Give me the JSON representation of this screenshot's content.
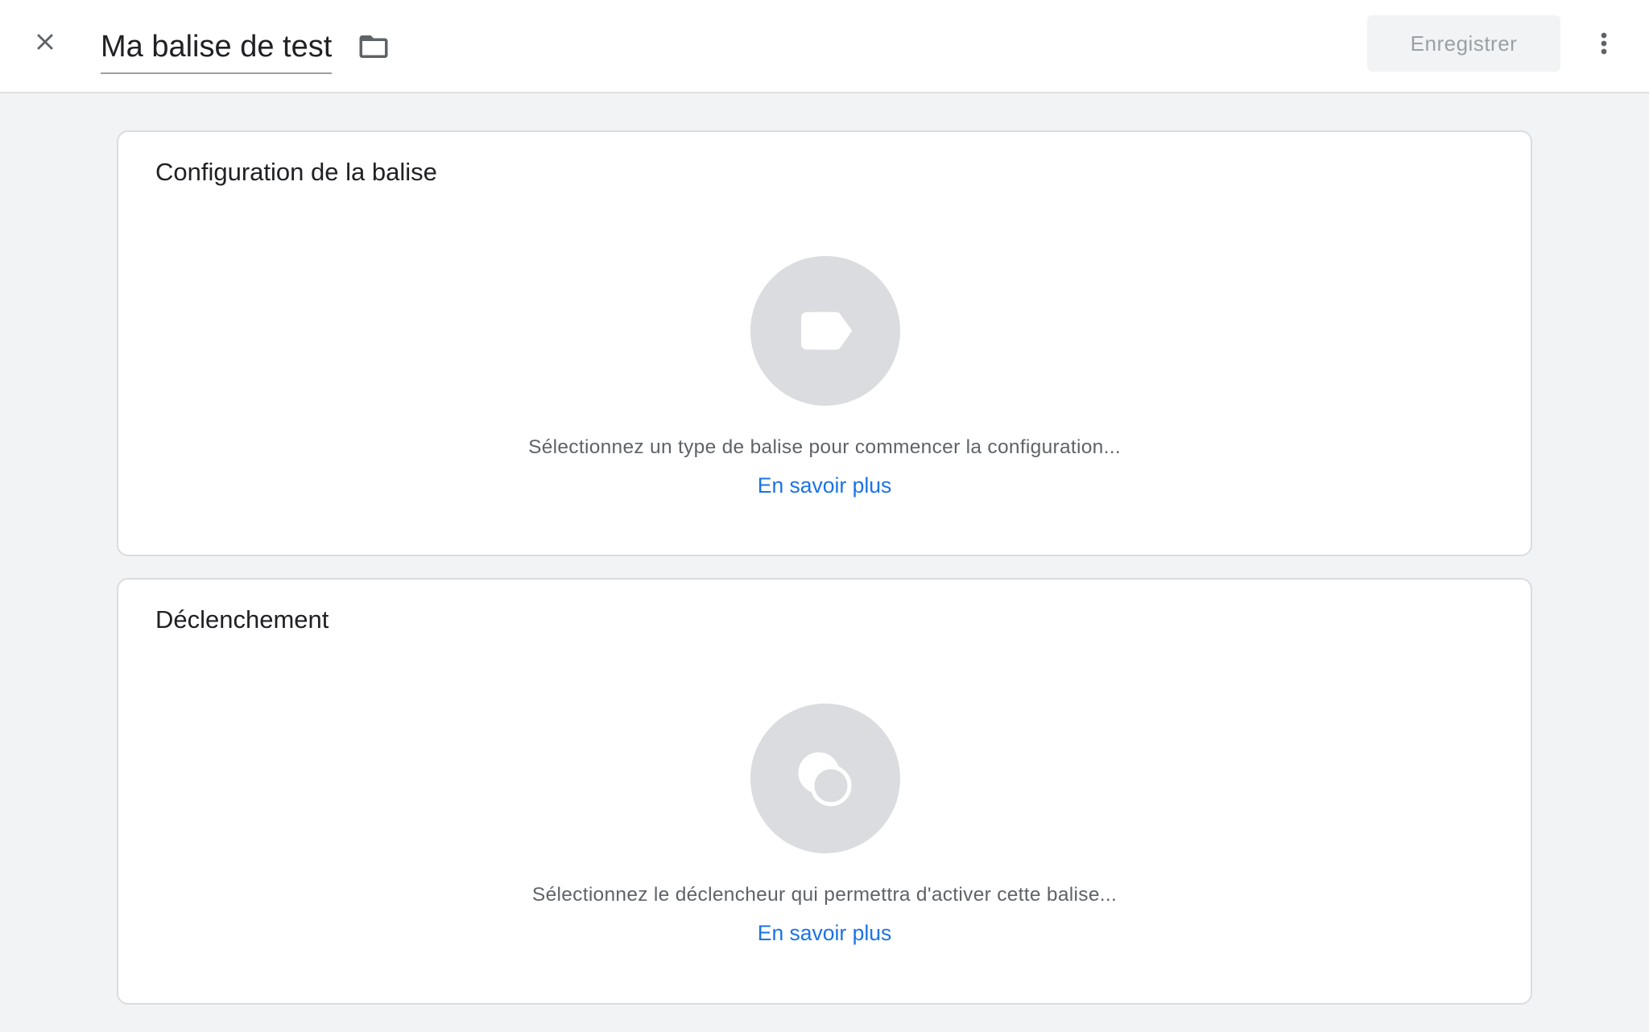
{
  "header": {
    "title": "Ma balise de test",
    "save_label": "Enregistrer",
    "close_icon": "close-icon",
    "folder_icon": "folder-icon",
    "more_icon": "more-vert-icon"
  },
  "cards": [
    {
      "title": "Configuration de la balise",
      "icon": "tag-icon",
      "description": "Sélectionnez un type de balise pour commencer la configuration...",
      "link": "En savoir plus"
    },
    {
      "title": "Déclenchement",
      "icon": "trigger-icon",
      "description": "Sélectionnez le déclencheur qui permettra d'activer cette balise...",
      "link": "En savoir plus"
    }
  ],
  "colors": {
    "background": "#f1f3f4",
    "link": "#1a73e8",
    "placeholder_circle": "#dadce0",
    "disabled_text": "#9aa0a6"
  }
}
